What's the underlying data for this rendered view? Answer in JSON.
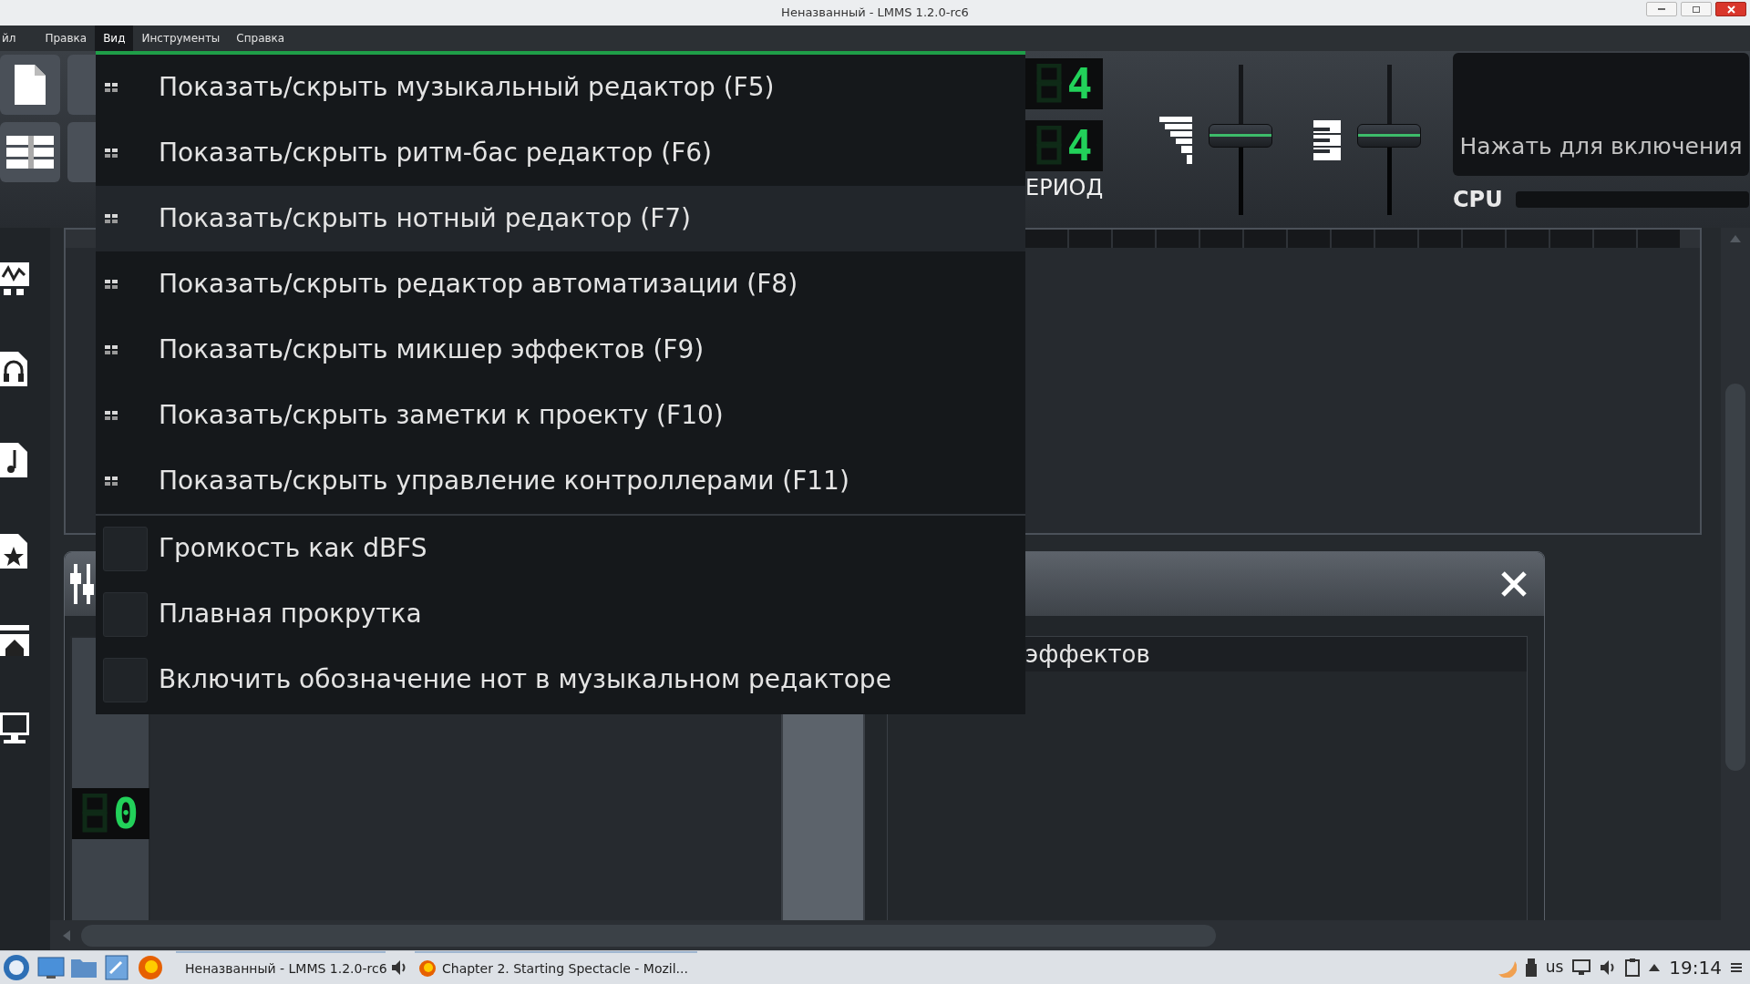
{
  "window": {
    "title": "Неназванный - LMMS 1.2.0-rc6"
  },
  "menubar": [
    {
      "label": "йл",
      "selected": false
    },
    {
      "label": "Правка",
      "selected": false
    },
    {
      "label": "Вид",
      "selected": true
    },
    {
      "label": "Инструменты",
      "selected": false
    },
    {
      "label": "Справка",
      "selected": false
    }
  ],
  "view_menu": [
    {
      "kind": "action",
      "label": "Показать/скрыть музыкальный редактор (F5)",
      "selected": false
    },
    {
      "kind": "action",
      "label": "Показать/скрыть ритм-бас редактор (F6)",
      "selected": false
    },
    {
      "kind": "action",
      "label": "Показать/скрыть нотный редактор (F7)",
      "selected": true
    },
    {
      "kind": "action",
      "label": "Показать/скрыть редактор автоматизации (F8)",
      "selected": false
    },
    {
      "kind": "action",
      "label": "Показать/скрыть микшер эффектов (F9)",
      "selected": false
    },
    {
      "kind": "action",
      "label": "Показать/скрыть заметки к проекту (F10)",
      "selected": false
    },
    {
      "kind": "action",
      "label": "Показать/скрыть управление контроллерами (F11)",
      "selected": false
    },
    {
      "kind": "check",
      "label": "Громкость как dBFS",
      "checked": false,
      "selected": false
    },
    {
      "kind": "check",
      "label": "Плавная прокрутка",
      "checked": false,
      "selected": false
    },
    {
      "kind": "check",
      "label": "Включить обозначение нот в музыкальном редакторе",
      "checked": false,
      "selected": false
    }
  ],
  "toolbar": {
    "lcd_displays": [
      "4",
      "4"
    ],
    "lcd_label": "ЕРИОД",
    "sliders": [
      {
        "level": 0.53
      },
      {
        "level": 0.53
      }
    ],
    "cpu_panel": {
      "message": "Нажать для включения",
      "label": "CPU"
    }
  },
  "effects_window": {
    "lcd_display": "0",
    "panel_header": "эффектов"
  },
  "taskbar": {
    "tasks": [
      {
        "label": "Неназванный - LMMS 1.2.0-rc6"
      },
      {
        "label": "Chapter 2. Starting Spectacle - Mozil..."
      }
    ],
    "keyboard_layout": "us",
    "clock": "19:14"
  }
}
